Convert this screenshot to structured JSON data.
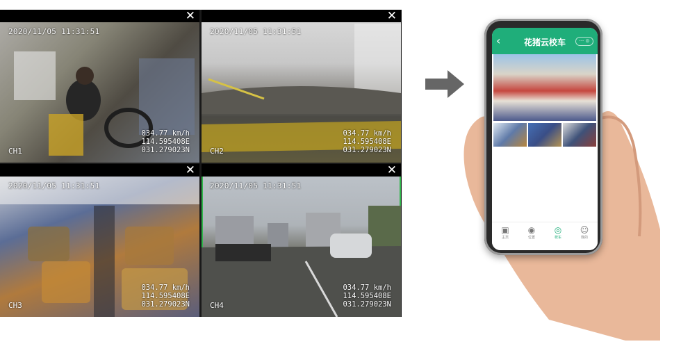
{
  "cameras": [
    {
      "timestamp": "2020/11/05 11:31:51",
      "channel": "CH1",
      "speed": "034.77 km/h",
      "longitude": "114.595408E",
      "latitude": "031.279023N",
      "close": "✕"
    },
    {
      "timestamp": "2020/11/05 11:31:51",
      "channel": "CH2",
      "speed": "034.77 km/h",
      "longitude": "114.595408E",
      "latitude": "031.279023N",
      "close": "✕"
    },
    {
      "timestamp": "2020/11/05 11:31:51",
      "channel": "CH3",
      "speed": "034.77 km/h",
      "longitude": "114.595408E",
      "latitude": "031.279023N",
      "close": "✕"
    },
    {
      "timestamp": "2020/11/05 11:31:51",
      "channel": "CH4",
      "speed": "034.77 km/h",
      "longitude": "114.595408E",
      "latitude": "031.279023N",
      "close": "✕"
    }
  ],
  "selected_channel": "CH4",
  "colors": {
    "selected_border": "#2fb54a",
    "app_green": "#1fae7a",
    "arrow": "#666666"
  },
  "phone": {
    "app_title": "花猪云校车",
    "back_icon": "chevron-left-icon",
    "capsule": "··· ⊙",
    "tabs": [
      {
        "label": "主页",
        "icon": "bus-icon"
      },
      {
        "label": "位置",
        "icon": "location-icon"
      },
      {
        "label": "校车",
        "icon": "camera-icon"
      },
      {
        "label": "我的",
        "icon": "user-icon"
      }
    ],
    "active_tab": "校车"
  }
}
